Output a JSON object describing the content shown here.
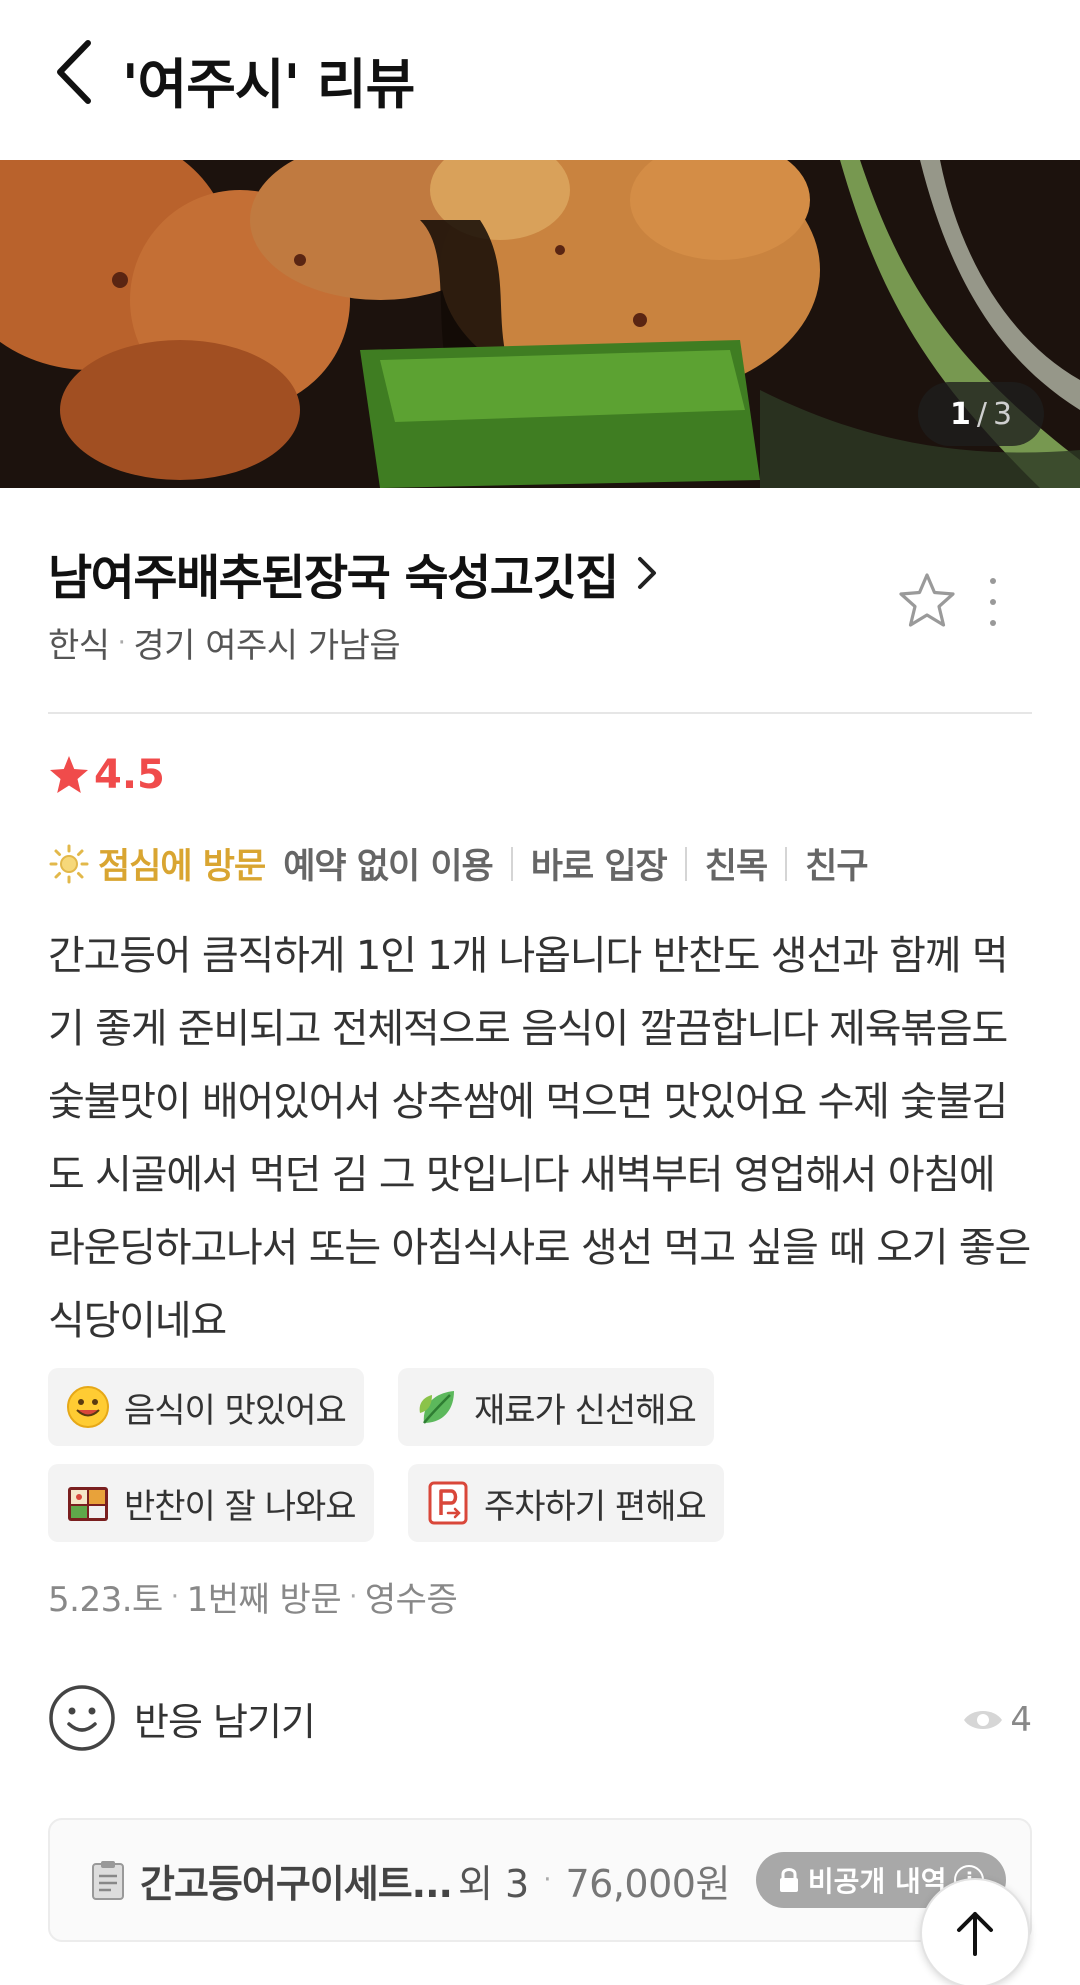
{
  "header": {
    "title": "'여주시' 리뷰",
    "back_icon": "chevron-left-icon"
  },
  "photo": {
    "current": "1",
    "separator": "/",
    "total": "3"
  },
  "place": {
    "name": "남여주배추된장국 숙성고깃집",
    "category": "한식",
    "location": "경기 여주시 가남읍",
    "separator": "·"
  },
  "review": {
    "rating": "4.5",
    "rating_color": "#f04b4b",
    "visit_time": "점심에 방문",
    "visit_time_color": "#d9a531",
    "tags": [
      "예약 없이 이용",
      "바로 입장",
      "친목",
      "친구"
    ],
    "text": "간고등어 큼직하게 1인 1개 나옵니다 반찬도 생선과 함께 먹기 좋게 준비되고 전체적으로 음식이 깔끔합니다 제육볶음도 숯불맛이 배어있어서 상추쌈에 먹으면 맛있어요 수제 숯불김도 시골에서 먹던 김 그 맛입니다 새벽부터 영업해서 아침에 라운딩하고나서 또는 아침식사로 생선 먹고 싶을 때 오기 좋은 식당이네요",
    "keywords": [
      {
        "label": "음식이 맛있어요",
        "icon": "smiley-icon"
      },
      {
        "label": "재료가 신선해요",
        "icon": "leaf-icon"
      },
      {
        "label": "반찬이 잘 나와요",
        "icon": "lunchbox-icon"
      },
      {
        "label": "주차하기 편해요",
        "icon": "parking-icon"
      }
    ],
    "date": "5.23.토",
    "visit_count": "1번째 방문",
    "verification": "영수증"
  },
  "reaction": {
    "label": "반응 남기기",
    "view_count": "4"
  },
  "order": {
    "item_name": "간고등어구이세트...",
    "extra": "외 3",
    "price": "76,000원",
    "private_label": "비공개 내역",
    "info_glyph": "i"
  }
}
